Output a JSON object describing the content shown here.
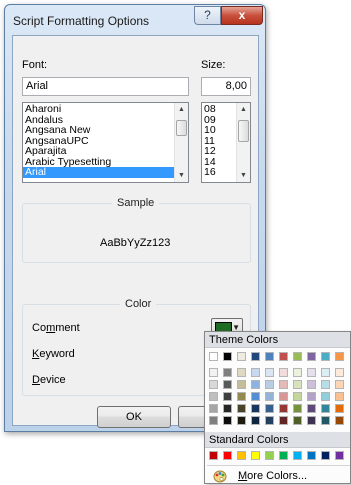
{
  "window": {
    "title": "Script Formatting Options",
    "help_glyph": "?",
    "close_glyph": "x"
  },
  "font": {
    "label": "Font:",
    "value": "Arial",
    "list": [
      "Aharoni",
      "Andalus",
      "Angsana New",
      "AngsanaUPC",
      "Aparajita",
      "Arabic Typesetting",
      "Arial"
    ],
    "selected": "Arial"
  },
  "size": {
    "label": "Size:",
    "value": "8,00",
    "list": [
      "08",
      "09",
      "10",
      "11",
      "12",
      "14",
      "16"
    ]
  },
  "sample": {
    "legend": "Sample",
    "text": "AaBbYyZz123"
  },
  "color": {
    "legend": "Color",
    "rows": [
      {
        "label": "Comment",
        "swatch": "#1e6b24"
      },
      {
        "label": "Keyword"
      },
      {
        "label": "Device"
      }
    ]
  },
  "buttons": {
    "ok": "OK",
    "cancel_partial": "Ca"
  },
  "color_popup": {
    "theme_header": "Theme Colors",
    "standard_header": "Standard Colors",
    "more_label": "More Colors...",
    "theme_base": [
      "#ffffff",
      "#000000",
      "#eeece1",
      "#1f497d",
      "#4f81bd",
      "#c0504d",
      "#9bbb59",
      "#8064a2",
      "#4bacc6",
      "#f79646"
    ],
    "theme_shades": [
      [
        "#f2f2f2",
        "#7f7f7f",
        "#ddd9c3",
        "#c6d9f0",
        "#dbe5f1",
        "#f2dcdb",
        "#ebf1dd",
        "#e5e0ec",
        "#dbeef3",
        "#fdeada"
      ],
      [
        "#d8d8d8",
        "#595959",
        "#c4bd97",
        "#8db3e2",
        "#b8cce4",
        "#e5b9b7",
        "#d7e3bc",
        "#ccc1d9",
        "#b7dde8",
        "#fbd5b5"
      ],
      [
        "#bfbfbf",
        "#3f3f3f",
        "#938953",
        "#548dd4",
        "#95b3d7",
        "#d99694",
        "#c3d69b",
        "#b2a2c7",
        "#92cddc",
        "#fac08f"
      ],
      [
        "#a5a5a5",
        "#262626",
        "#494429",
        "#17365d",
        "#366092",
        "#953734",
        "#76923c",
        "#5f497a",
        "#31859b",
        "#e36c09"
      ],
      [
        "#7f7f7f",
        "#0c0c0c",
        "#1d1b10",
        "#0f243e",
        "#244061",
        "#632423",
        "#4f6128",
        "#3f3151",
        "#205867",
        "#974806"
      ]
    ],
    "standard": [
      "#c00000",
      "#ff0000",
      "#ffc000",
      "#ffff00",
      "#92d050",
      "#00b050",
      "#00b0f0",
      "#0070c0",
      "#002060",
      "#7030a0"
    ]
  }
}
